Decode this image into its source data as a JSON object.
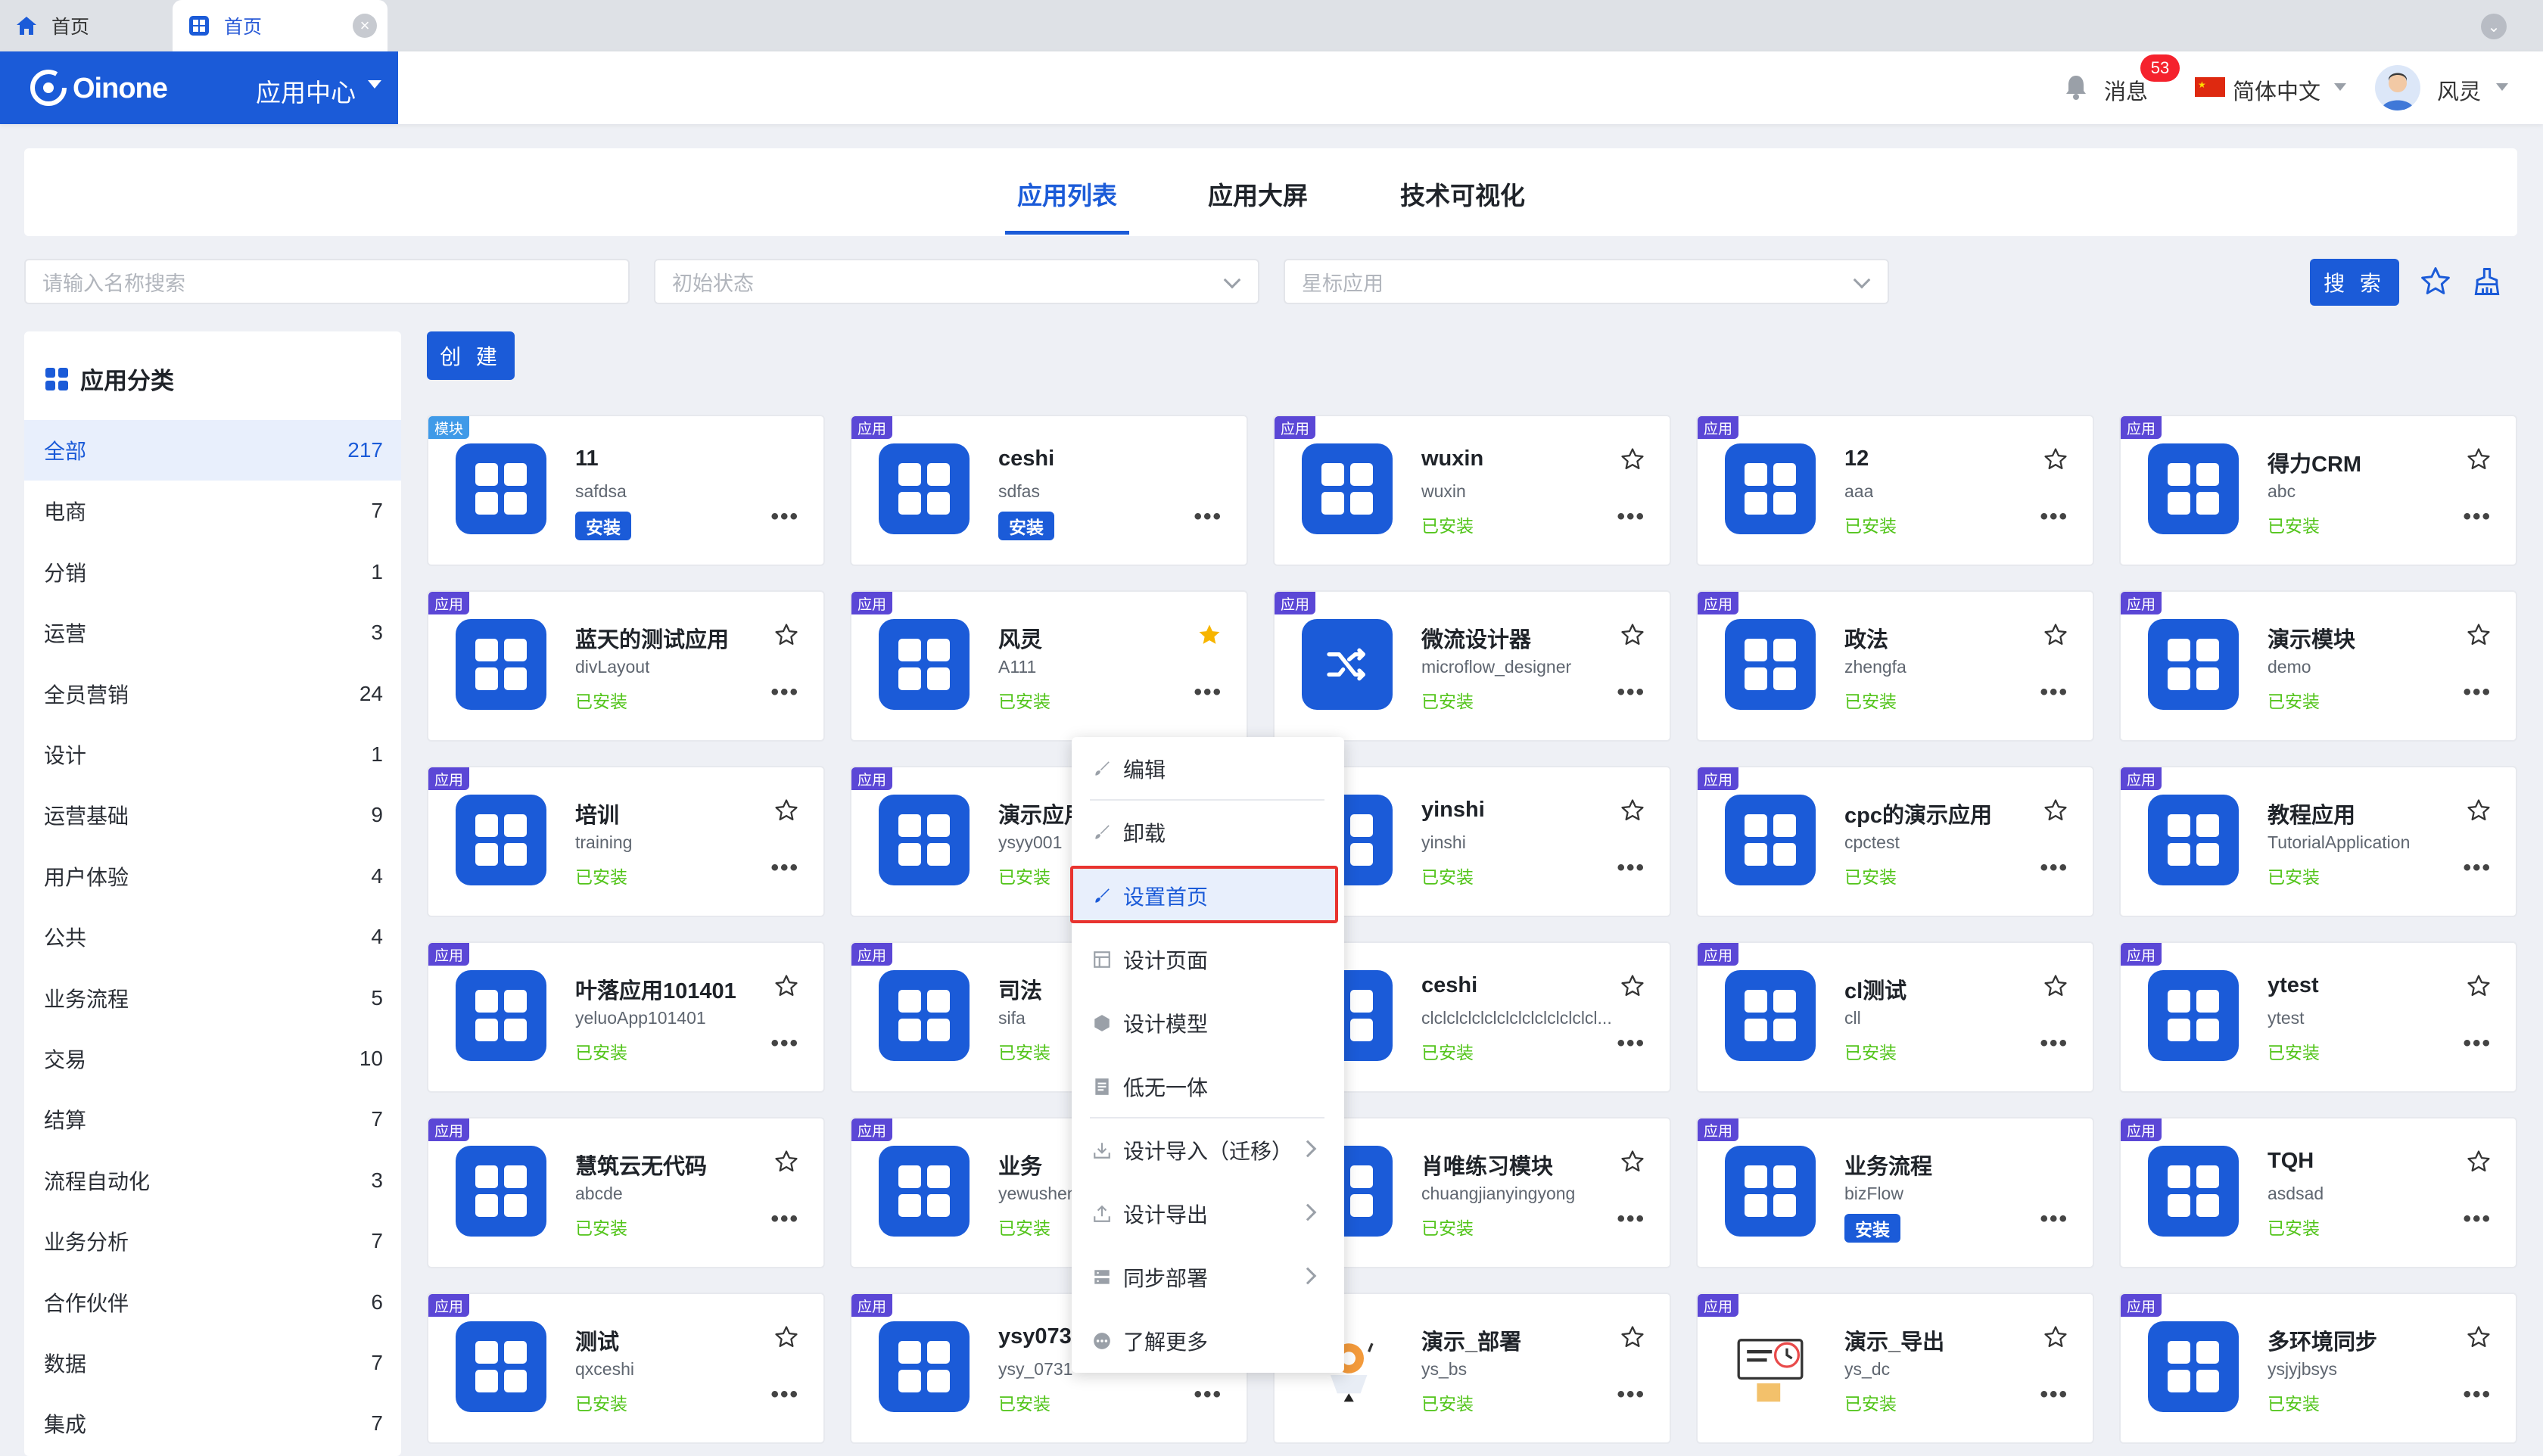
{
  "browser": {
    "tabs": [
      {
        "label": "首页"
      },
      {
        "label": "首页"
      }
    ]
  },
  "header": {
    "brand": "Oinone",
    "app_center": "应用中心",
    "messages_label": "消息",
    "messages_count": "53",
    "language": "简体中文",
    "user": "风灵"
  },
  "main_tabs": [
    {
      "label": "应用列表",
      "active": true
    },
    {
      "label": "应用大屏",
      "active": false
    },
    {
      "label": "技术可视化",
      "active": false
    }
  ],
  "filters": {
    "search_placeholder": "请输入名称搜索",
    "status_placeholder": "初始状态",
    "star_placeholder": "星标应用",
    "search_button": "搜 索",
    "create_button": "创 建"
  },
  "sidebar": {
    "title": "应用分类",
    "items": [
      {
        "label": "全部",
        "count": "217",
        "active": true
      },
      {
        "label": "电商",
        "count": "7"
      },
      {
        "label": "分销",
        "count": "1"
      },
      {
        "label": "运营",
        "count": "3"
      },
      {
        "label": "全员营销",
        "count": "24"
      },
      {
        "label": "设计",
        "count": "1"
      },
      {
        "label": "运营基础",
        "count": "9"
      },
      {
        "label": "用户体验",
        "count": "4"
      },
      {
        "label": "公共",
        "count": "4"
      },
      {
        "label": "业务流程",
        "count": "5"
      },
      {
        "label": "交易",
        "count": "10"
      },
      {
        "label": "结算",
        "count": "7"
      },
      {
        "label": "流程自动化",
        "count": "3"
      },
      {
        "label": "业务分析",
        "count": "7"
      },
      {
        "label": "合作伙伴",
        "count": "6"
      },
      {
        "label": "数据",
        "count": "7"
      },
      {
        "label": "集成",
        "count": "7"
      }
    ]
  },
  "cards": [
    {
      "tag": "模块",
      "title": "11",
      "code": "safdsa",
      "status": "安装",
      "installed": false,
      "star": "none",
      "icon": "grid"
    },
    {
      "tag": "应用",
      "title": "ceshi",
      "code": "sdfas",
      "status": "安装",
      "installed": false,
      "star": "none",
      "icon": "grid"
    },
    {
      "tag": "应用",
      "title": "wuxin",
      "code": "wuxin",
      "status": "已安装",
      "installed": true,
      "star": "outline",
      "icon": "grid"
    },
    {
      "tag": "应用",
      "title": "12",
      "code": "aaa",
      "status": "已安装",
      "installed": true,
      "star": "outline",
      "icon": "grid"
    },
    {
      "tag": "应用",
      "title": "得力CRM",
      "code": "abc",
      "status": "已安装",
      "installed": true,
      "star": "outline",
      "icon": "grid"
    },
    {
      "tag": "应用",
      "title": "蓝天的测试应用",
      "code": "divLayout",
      "status": "已安装",
      "installed": true,
      "star": "outline",
      "icon": "grid"
    },
    {
      "tag": "应用",
      "title": "风灵",
      "code": "A111",
      "status": "已安装",
      "installed": true,
      "star": "filled",
      "icon": "grid"
    },
    {
      "tag": "应用",
      "title": "微流设计器",
      "code": "microflow_designer",
      "status": "已安装",
      "installed": true,
      "star": "outline",
      "icon": "shuffle"
    },
    {
      "tag": "应用",
      "title": "政法",
      "code": "zhengfa",
      "status": "已安装",
      "installed": true,
      "star": "outline",
      "icon": "grid"
    },
    {
      "tag": "应用",
      "title": "演示模块",
      "code": "demo",
      "status": "已安装",
      "installed": true,
      "star": "outline",
      "icon": "grid"
    },
    {
      "tag": "应用",
      "title": "培训",
      "code": "training",
      "status": "已安装",
      "installed": true,
      "star": "outline",
      "icon": "grid"
    },
    {
      "tag": "应用",
      "title": "演示应用",
      "code": "ysyy001",
      "status": "已安装",
      "installed": true,
      "star": "outline",
      "icon": "grid"
    },
    {
      "tag": "应用",
      "title": "yinshi",
      "code": "yinshi",
      "status": "已安装",
      "installed": true,
      "star": "outline",
      "icon": "grid"
    },
    {
      "tag": "应用",
      "title": "cpc的演示应用",
      "code": "cpctest",
      "status": "已安装",
      "installed": true,
      "star": "outline",
      "icon": "grid"
    },
    {
      "tag": "应用",
      "title": "教程应用",
      "code": "TutorialApplication",
      "status": "已安装",
      "installed": true,
      "star": "outline",
      "icon": "grid"
    },
    {
      "tag": "应用",
      "title": "叶落应用101401",
      "code": "yeluoApp101401",
      "status": "已安装",
      "installed": true,
      "star": "outline",
      "icon": "grid"
    },
    {
      "tag": "应用",
      "title": "司法",
      "code": "sifa",
      "status": "已安装",
      "installed": true,
      "star": "outline",
      "icon": "grid"
    },
    {
      "tag": "应用",
      "title": "ceshi",
      "code": "clclclclclclclclclclclclclcl...",
      "status": "已安装",
      "installed": true,
      "star": "outline",
      "icon": "grid"
    },
    {
      "tag": "应用",
      "title": "cl测试",
      "code": "cll",
      "status": "已安装",
      "installed": true,
      "star": "outline",
      "icon": "grid"
    },
    {
      "tag": "应用",
      "title": "ytest",
      "code": "ytest",
      "status": "已安装",
      "installed": true,
      "star": "outline",
      "icon": "grid"
    },
    {
      "tag": "应用",
      "title": "慧筑云无代码",
      "code": "abcde",
      "status": "已安装",
      "installed": true,
      "star": "outline",
      "icon": "grid"
    },
    {
      "tag": "应用",
      "title": "业务",
      "code": "yewushen",
      "status": "已安装",
      "installed": true,
      "star": "outline",
      "icon": "grid"
    },
    {
      "tag": "应用",
      "title": "肖唯练习模块",
      "code": "chuangjianyingyong",
      "status": "已安装",
      "installed": true,
      "star": "outline",
      "icon": "grid"
    },
    {
      "tag": "应用",
      "title": "业务流程",
      "code": "bizFlow",
      "status": "安装",
      "installed": false,
      "star": "none",
      "icon": "grid"
    },
    {
      "tag": "应用",
      "title": "TQH",
      "code": "asdsad",
      "status": "已安装",
      "installed": true,
      "star": "outline",
      "icon": "grid"
    },
    {
      "tag": "应用",
      "title": "测试",
      "code": "qxceshi",
      "status": "已安装",
      "installed": true,
      "star": "outline",
      "icon": "grid"
    },
    {
      "tag": "应用",
      "title": "ysy0731",
      "code": "ysy_0731",
      "status": "已安装",
      "installed": true,
      "star": "outline",
      "icon": "grid"
    },
    {
      "tag": "应用",
      "title": "演示_部署",
      "code": "ys_bs",
      "status": "已安装",
      "installed": true,
      "star": "outline",
      "icon": "deploy-illustration"
    },
    {
      "tag": "应用",
      "title": "演示_导出",
      "code": "ys_dc",
      "status": "已安装",
      "installed": true,
      "star": "outline",
      "icon": "export-illustration"
    },
    {
      "tag": "应用",
      "title": "多环境同步",
      "code": "ysjyjbsys",
      "status": "已安装",
      "installed": true,
      "star": "outline",
      "icon": "grid"
    }
  ],
  "context_menu": {
    "items": [
      {
        "label": "编辑",
        "icon": "brush-icon",
        "submenu": false
      },
      {
        "label": "卸载",
        "icon": "brush-icon",
        "submenu": false
      },
      {
        "label": "设置首页",
        "icon": "brush-icon",
        "submenu": false,
        "highlighted": true
      },
      {
        "label": "设计页面",
        "icon": "page-icon",
        "submenu": false
      },
      {
        "label": "设计模型",
        "icon": "cube-icon",
        "submenu": false
      },
      {
        "label": "低无一体",
        "icon": "doc-icon",
        "submenu": false
      },
      {
        "label": "设计导入（迁移）",
        "icon": "import-icon",
        "submenu": true
      },
      {
        "label": "设计导出",
        "icon": "export-icon",
        "submenu": true
      },
      {
        "label": "同步部署",
        "icon": "server-icon",
        "submenu": true
      },
      {
        "label": "了解更多",
        "icon": "more-circle-icon",
        "submenu": false
      }
    ]
  },
  "colors": {
    "primary": "#1b5bd8",
    "installed_green": "#52c41a",
    "tag_purple": "#5b47d6",
    "tag_module_blue": "#3f9ae8",
    "star_gold": "#f7b500",
    "highlight_red": "#e8332f",
    "badge_red": "#f5222d"
  }
}
